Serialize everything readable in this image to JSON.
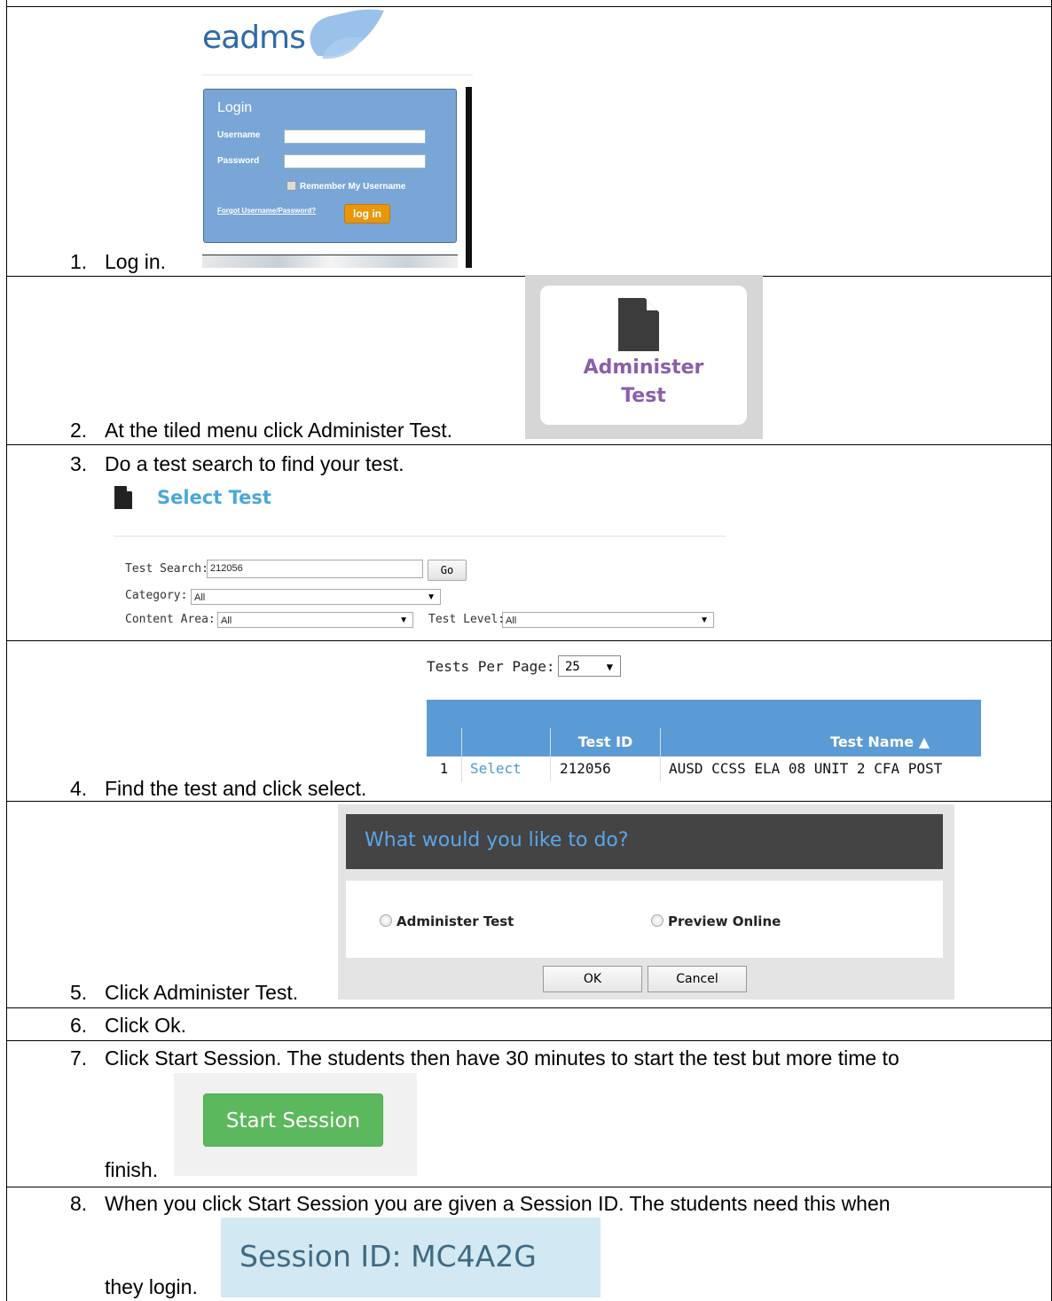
{
  "steps": [
    {
      "num": "1.",
      "text": "Log in."
    },
    {
      "num": "2.",
      "text": "At the tiled menu click Administer Test."
    },
    {
      "num": "3.",
      "text": "Do a test search to find your test."
    },
    {
      "num": "4.",
      "text": "Find the test and click select."
    },
    {
      "num": "5.",
      "text": "Click Administer Test."
    },
    {
      "num": "6.",
      "text": "Click Ok."
    },
    {
      "num": "7.",
      "text": "Click Start Session. The students then have 30 minutes to start the test but more time to",
      "continuation": "finish."
    },
    {
      "num": "8.",
      "text": "When you click Start Session you are given a Session ID. The students need this when",
      "continuation": "they login."
    }
  ],
  "login": {
    "logo_text": "eadms",
    "title": "Login",
    "username_label": "Username",
    "password_label": "Password",
    "remember_label": "Remember My Username",
    "forgot_link": "Forgot Username/Password?",
    "login_button": "log in"
  },
  "tile": {
    "icon": "document-icon",
    "label_line1": "Administer",
    "label_line2": "Test",
    "label_color": "#8b5fab"
  },
  "select_test": {
    "title": "Select Test",
    "icon": "document-icon",
    "test_search_label": "Test Search:",
    "test_search_value": "212056",
    "go_button": "Go",
    "category_label": "Category:",
    "category_value": "All",
    "content_area_label": "Content Area:",
    "content_area_value": "All",
    "test_level_label": "Test Level:",
    "test_level_value": "All"
  },
  "results": {
    "tests_per_page_label": "Tests Per Page:",
    "tests_per_page_value": "25",
    "columns": [
      "",
      "",
      "Test ID",
      "Test Name ▲"
    ],
    "rows": [
      {
        "num": "1",
        "action": "Select",
        "test_id": "212056",
        "test_name": "AUSD CCSS ELA 08 UNIT 2 CFA POST"
      }
    ],
    "header_color": "#5b9bd5"
  },
  "dialog": {
    "title": "What would you like to do?",
    "option1": "Administer Test",
    "option2": "Preview Online",
    "ok_button": "OK",
    "cancel_button": "Cancel"
  },
  "start_session": {
    "button_label": "Start Session",
    "button_color": "#5cb85c"
  },
  "session": {
    "label": "Session ID: MC4A2G"
  }
}
